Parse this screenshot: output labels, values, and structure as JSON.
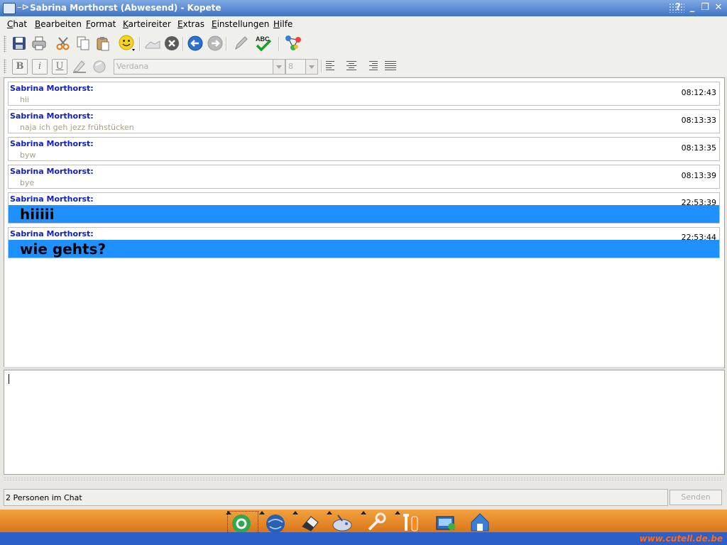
{
  "window": {
    "title": "Sabrina Morthorst (Abwesend) - Kopete",
    "pin_symbol": "–⊳",
    "btn_help": "?",
    "btn_min": "_",
    "btn_max": "❐",
    "btn_close": "✕"
  },
  "menu": [
    "Chat",
    "Bearbeiten",
    "Format",
    "Karteireiter",
    "Extras",
    "Einstellungen",
    "Hilfe"
  ],
  "format": {
    "bold": "B",
    "italic": "i",
    "underline": "U",
    "font": "Verdana",
    "size": "8"
  },
  "messages": [
    {
      "sender": "Sabrina Morthorst:",
      "time": "08:12:43",
      "text": "hii",
      "highlight": false
    },
    {
      "sender": "Sabrina Morthorst:",
      "time": "08:13:33",
      "text": "naja ich geh jezz frühstücken",
      "highlight": false
    },
    {
      "sender": "Sabrina Morthorst:",
      "time": "08:13:35",
      "text": "byw",
      "highlight": false
    },
    {
      "sender": "Sabrina Morthorst:",
      "time": "08:13:39",
      "text": "bye",
      "highlight": false
    },
    {
      "sender": "Sabrina Morthorst:",
      "time": "22:53:39",
      "text": "hiiiii",
      "highlight": true
    },
    {
      "sender": "Sabrina Morthorst:",
      "time": "22:53:44",
      "text": "wie gehts?",
      "highlight": true
    }
  ],
  "status": {
    "text": "2 Personen im Chat"
  },
  "send_button": "Senden",
  "branding": "www.cutell.de.be",
  "colors": {
    "highlight": "#1e90ff",
    "sender": "#1020c8",
    "titlebar": "#3f74c7",
    "panel": "#e8861f"
  }
}
